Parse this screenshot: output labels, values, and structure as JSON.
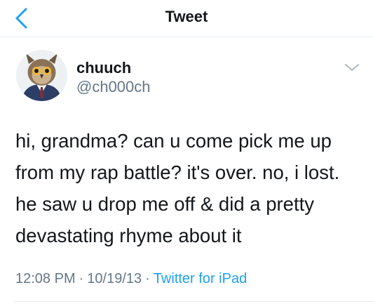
{
  "header": {
    "title": "Tweet",
    "back_icon": "chevron-left-icon"
  },
  "tweet": {
    "author": {
      "display_name": "chuuch",
      "handle": "@ch000ch",
      "avatar": "owl-in-suit-avatar"
    },
    "menu_icon": "chevron-down-icon",
    "text": "hi, grandma? can u come pick me up\nfrom my rap battle? it's over. no, i lost.\nhe saw u drop me off & did a pretty\ndevastating rhyme about it",
    "time": "12:08 PM",
    "date": "10/19/13",
    "separator": "·",
    "source": "Twitter for iPad"
  },
  "colors": {
    "accent": "#1da1f2",
    "text": "#14171a",
    "secondary_text": "#657786",
    "divider": "#e6ecf0"
  }
}
